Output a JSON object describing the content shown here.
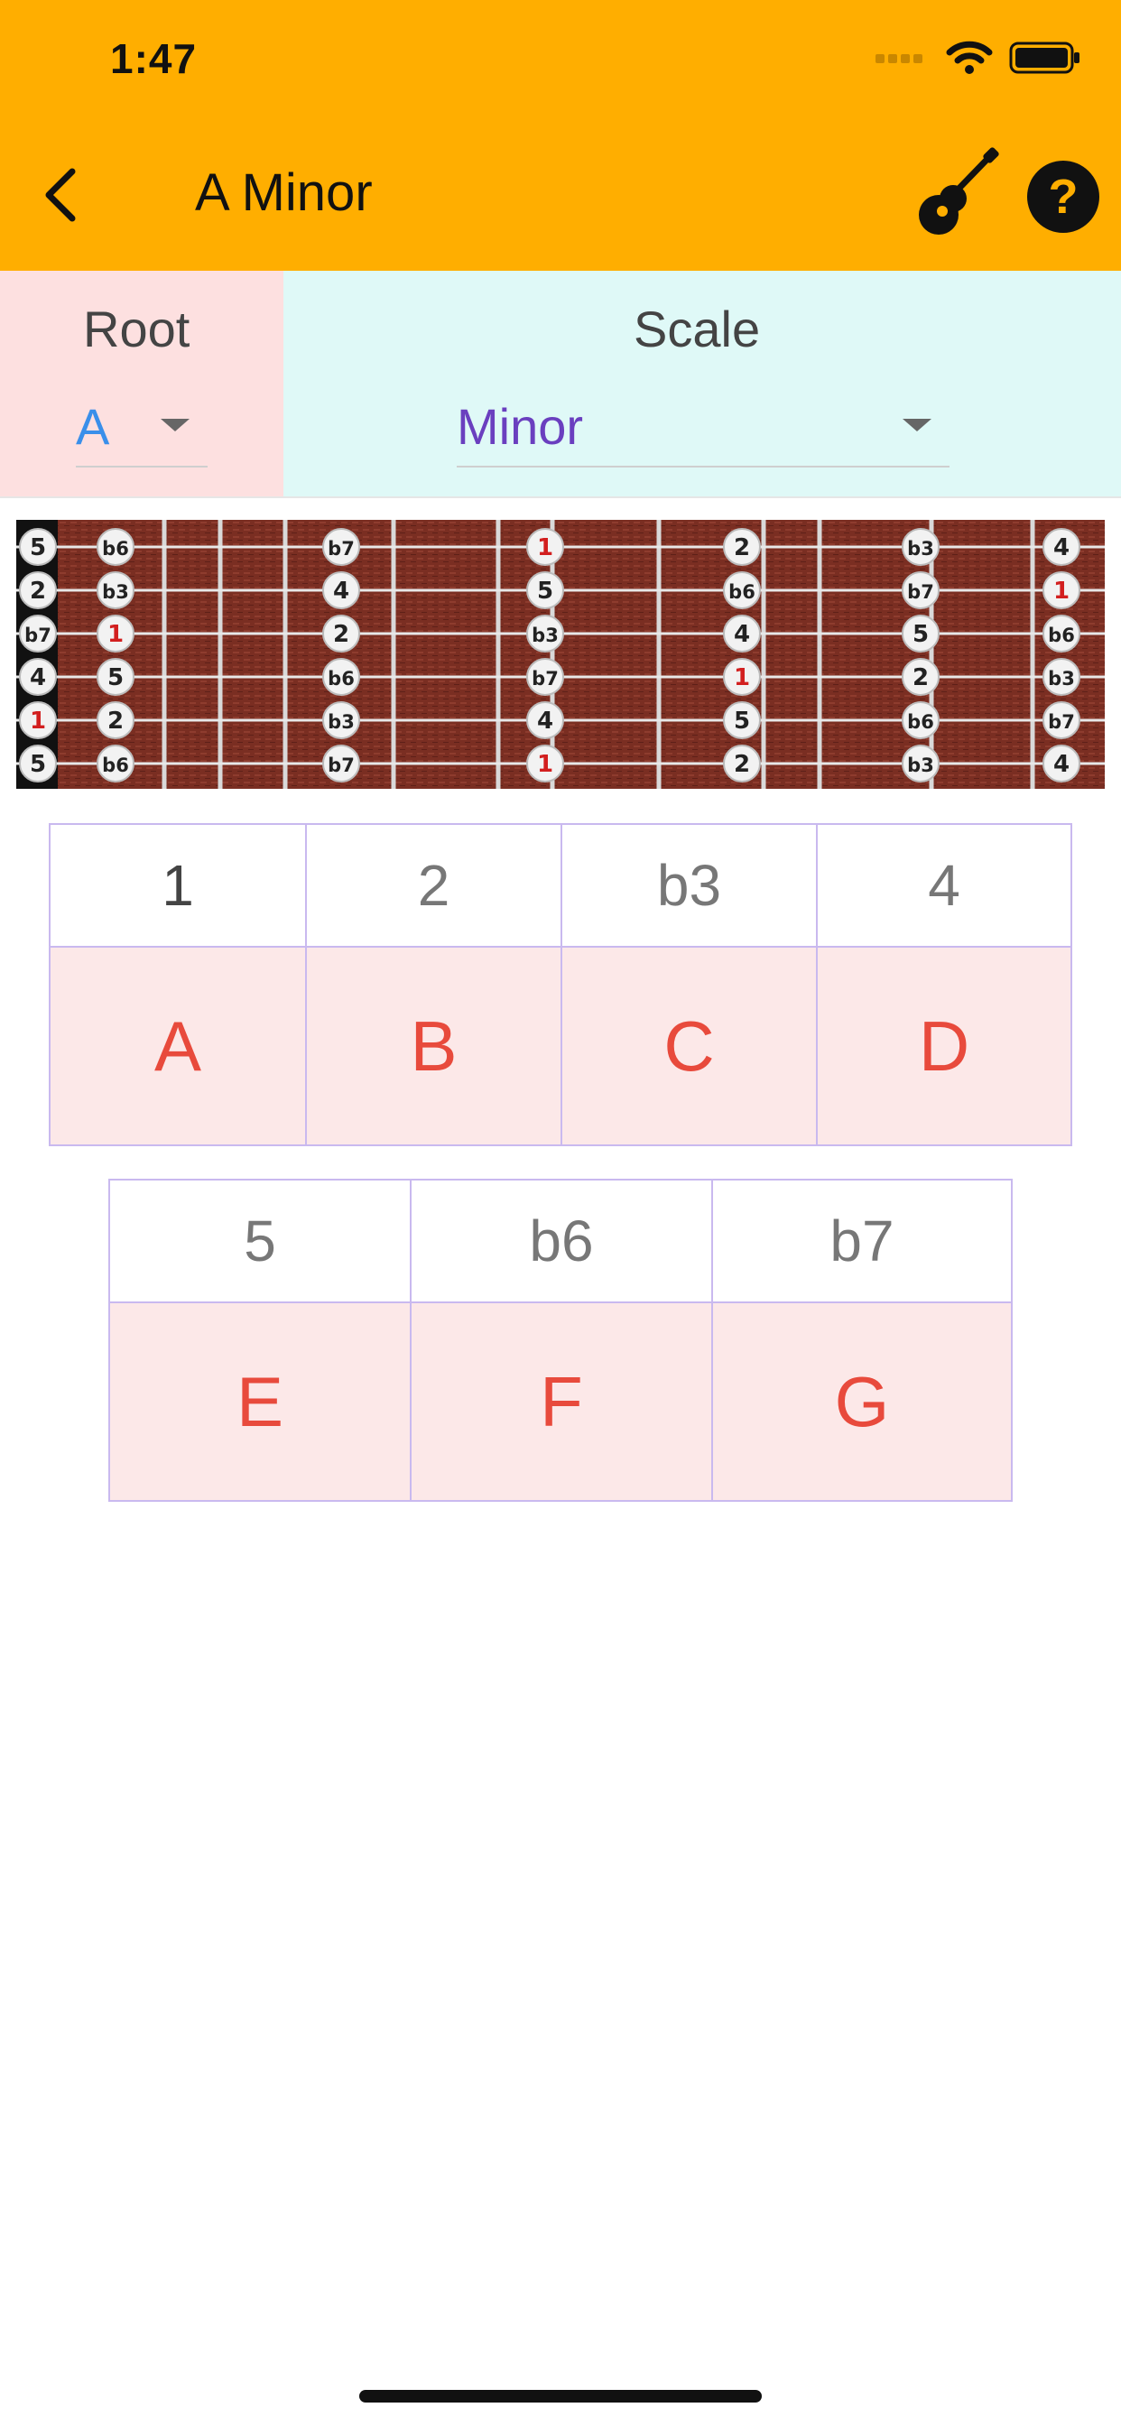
{
  "status_bar": {
    "time": "1:47"
  },
  "app_bar": {
    "title": "A Minor",
    "background": "#FFAE00"
  },
  "selectors": {
    "root": {
      "label": "Root",
      "value": "A",
      "value_color": "#3A8FEA"
    },
    "scale": {
      "label": "Scale",
      "value": "Minor",
      "value_color": "#6A3FBF"
    }
  },
  "fretboard": {
    "string_tuning": [
      "5",
      "2",
      "b7",
      "4",
      "1",
      "5"
    ],
    "rows": [
      [
        "b6",
        "b7",
        "1",
        "2",
        "b3",
        "4"
      ],
      [
        "b3",
        "4",
        "5",
        "b6",
        "b7",
        "1"
      ],
      [
        "1",
        "2",
        "b3",
        "4",
        "5",
        "b6"
      ],
      [
        "5",
        "b6",
        "b7",
        "1",
        "2",
        "b3"
      ],
      [
        "2",
        "b3",
        "4",
        "5",
        "b6",
        "b7"
      ],
      [
        "b6",
        "b7",
        "1",
        "2",
        "b3",
        "4"
      ]
    ]
  },
  "note_table_1": [
    {
      "degree": "1",
      "note": "A"
    },
    {
      "degree": "2",
      "note": "B"
    },
    {
      "degree": "b3",
      "note": "C"
    },
    {
      "degree": "4",
      "note": "D"
    }
  ],
  "note_table_2": [
    {
      "degree": "5",
      "note": "E"
    },
    {
      "degree": "b6",
      "note": "F"
    },
    {
      "degree": "b7",
      "note": "G"
    }
  ]
}
